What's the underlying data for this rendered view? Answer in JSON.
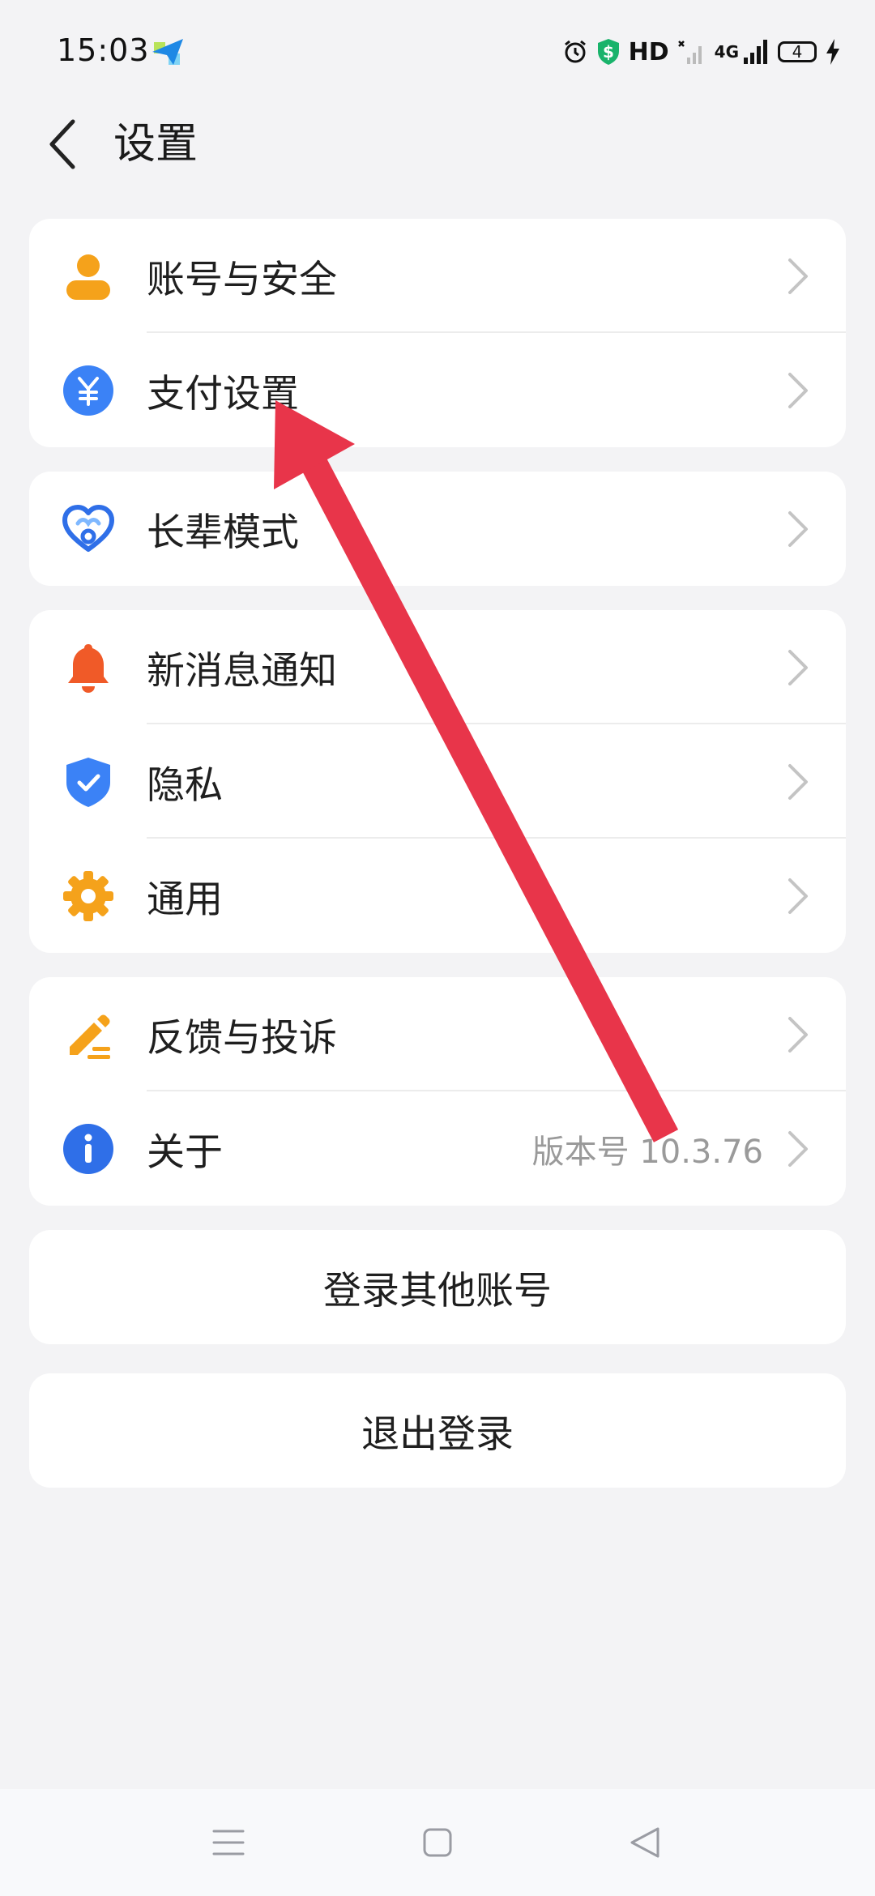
{
  "status_bar": {
    "time": "15:03",
    "hd_label": "HD",
    "network_label": "4G",
    "battery_level": "4"
  },
  "header": {
    "title": "设置"
  },
  "groups": [
    {
      "items": [
        {
          "label": "账号与安全",
          "icon": "user-icon",
          "color": "#F5A21B"
        },
        {
          "label": "支付设置",
          "icon": "yuan-icon",
          "color": "#3B82F6"
        }
      ]
    },
    {
      "items": [
        {
          "label": "长辈模式",
          "icon": "heart-icon",
          "color": "#2F6FE8"
        }
      ]
    },
    {
      "items": [
        {
          "label": "新消息通知",
          "icon": "bell-icon",
          "color": "#F05A28"
        },
        {
          "label": "隐私",
          "icon": "shield-icon",
          "color": "#3B82F6"
        },
        {
          "label": "通用",
          "icon": "gear-icon",
          "color": "#F5A21B"
        }
      ]
    },
    {
      "items": [
        {
          "label": "反馈与投诉",
          "icon": "pencil-icon",
          "color": "#F5A21B"
        },
        {
          "label": "关于",
          "icon": "info-icon",
          "color": "#2F6FE8",
          "value": "版本号 10.3.76"
        }
      ]
    }
  ],
  "buttons": {
    "switch_account": "登录其他账号",
    "logout": "退出登录"
  },
  "colors": {
    "arrow": "#E8354A",
    "background": "#F3F3F5"
  }
}
